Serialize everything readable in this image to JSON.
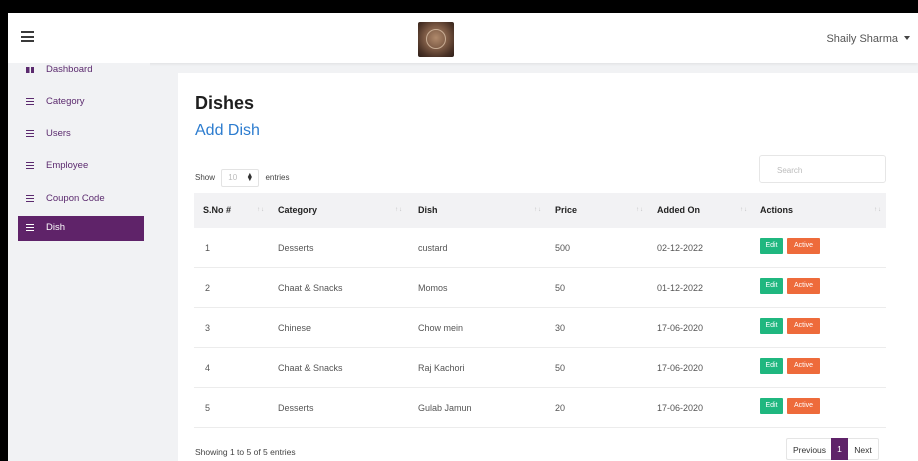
{
  "header": {
    "user_name": "Shaily Sharma"
  },
  "sidebar": {
    "items": [
      {
        "label": "Dashboard",
        "icon": "dashboard-icon"
      },
      {
        "label": "Category",
        "icon": "list-icon"
      },
      {
        "label": "Users",
        "icon": "list-icon"
      },
      {
        "label": "Employee",
        "icon": "list-icon"
      },
      {
        "label": "Coupon Code",
        "icon": "list-icon"
      },
      {
        "label": "Dish",
        "icon": "list-icon",
        "active": true
      }
    ]
  },
  "main": {
    "title": "Dishes",
    "add_link": "Add Dish",
    "length": {
      "show": "Show",
      "value": "10",
      "entries": "entries"
    },
    "search_placeholder": "Search",
    "columns": [
      "S.No #",
      "Category",
      "Dish",
      "Price",
      "Added On",
      "Actions"
    ],
    "rows": [
      {
        "sno": "1",
        "category": "Desserts",
        "dish": "custard",
        "price": "500",
        "added_on": "02-12-2022",
        "edit": "Edit",
        "status": "Active"
      },
      {
        "sno": "2",
        "category": "Chaat & Snacks",
        "dish": "Momos",
        "price": "50",
        "added_on": "01-12-2022",
        "edit": "Edit",
        "status": "Active"
      },
      {
        "sno": "3",
        "category": "Chinese",
        "dish": "Chow mein",
        "price": "30",
        "added_on": "17-06-2020",
        "edit": "Edit",
        "status": "Active"
      },
      {
        "sno": "4",
        "category": "Chaat & Snacks",
        "dish": "Raj Kachori",
        "price": "50",
        "added_on": "17-06-2020",
        "edit": "Edit",
        "status": "Active"
      },
      {
        "sno": "5",
        "category": "Desserts",
        "dish": "Gulab Jamun",
        "price": "20",
        "added_on": "17-06-2020",
        "edit": "Edit",
        "status": "Active"
      }
    ],
    "info": "Showing 1 to 5 of 5 entries",
    "pagination": {
      "previous": "Previous",
      "current": "1",
      "next": "Next"
    }
  },
  "colors": {
    "brand": "#5f2369",
    "link": "#2c7ccf",
    "edit": "#1fb77f",
    "active": "#ee6b3b"
  }
}
